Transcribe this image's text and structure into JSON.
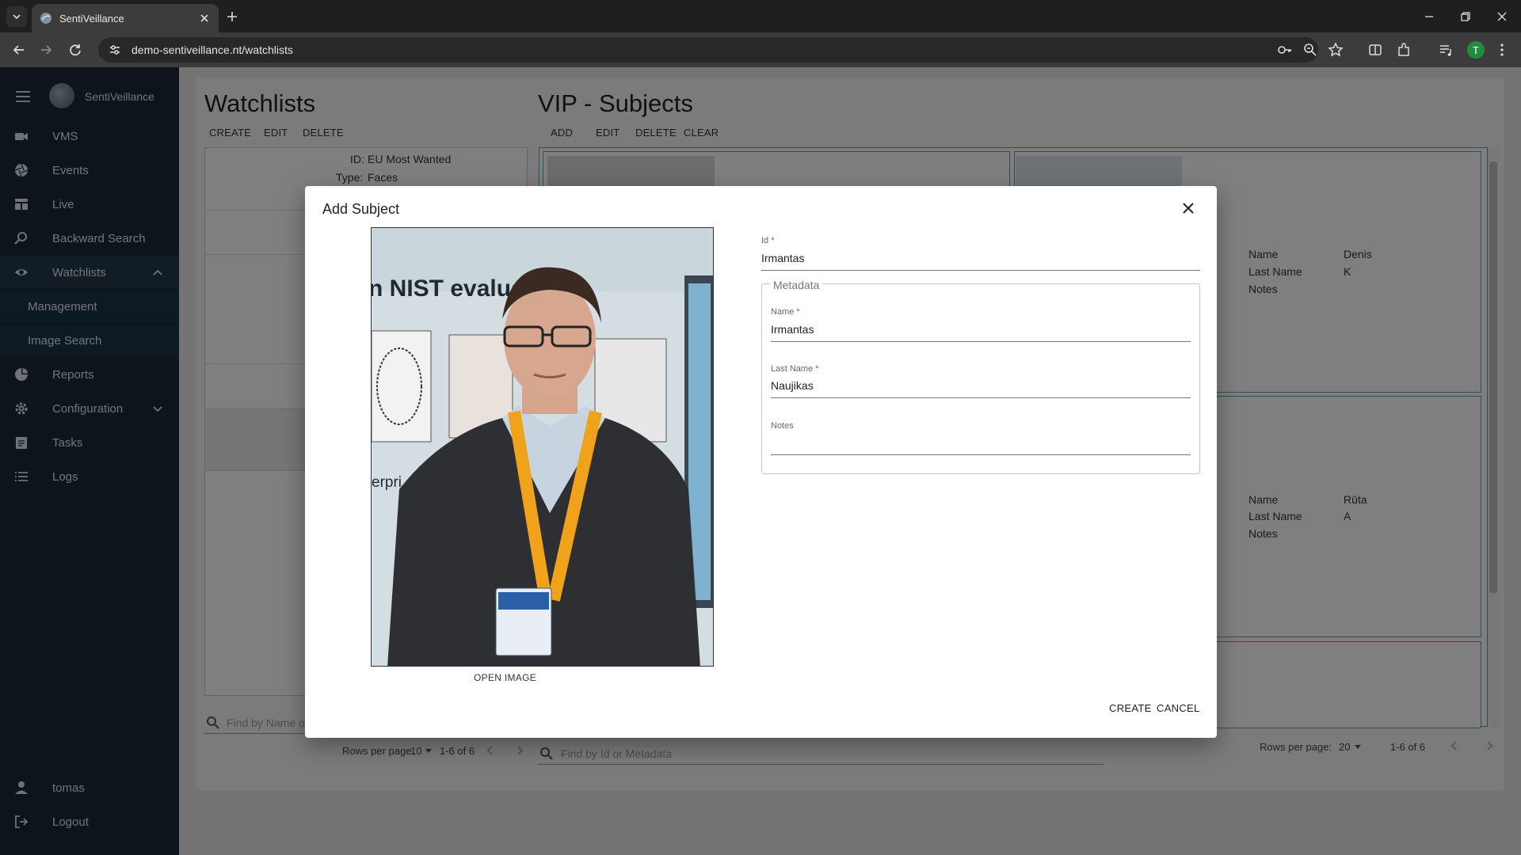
{
  "browser": {
    "tab_title": "SentiVeillance",
    "url": "demo-sentiveillance.nt/watchlists",
    "profile_initial": "T",
    "icons": [
      "tab-search-icon",
      "close-icon",
      "plus-icon",
      "minimize-icon",
      "restore-icon",
      "close-window-icon",
      "back-icon",
      "forward-icon",
      "reload-icon",
      "site-info-icon",
      "key-icon",
      "zoom-icon",
      "star-icon",
      "reading-mode-icon",
      "extensions-icon",
      "media-icon",
      "menu-dots-icon"
    ]
  },
  "sidebar": {
    "brand": "SentiVeillance",
    "items": [
      {
        "label": "VMS",
        "icon": "camera-icon"
      },
      {
        "label": "Events",
        "icon": "aperture-icon"
      },
      {
        "label": "Live",
        "icon": "grid-icon"
      },
      {
        "label": "Backward Search",
        "icon": "search-icon"
      },
      {
        "label": "Watchlists",
        "icon": "eye-icon"
      },
      {
        "label": "Management",
        "icon": ""
      },
      {
        "label": "Image Search",
        "icon": ""
      },
      {
        "label": "Reports",
        "icon": "pie-icon"
      },
      {
        "label": "Configuration",
        "icon": "gear-icon"
      },
      {
        "label": "Tasks",
        "icon": "clipboard-icon"
      },
      {
        "label": "Logs",
        "icon": "list-icon"
      }
    ],
    "user": "tomas",
    "logout": "Logout"
  },
  "watchlists": {
    "title": "Watchlists",
    "toolbar": {
      "create": "CREATE",
      "edit": "EDIT",
      "delete": "DELETE"
    },
    "selected": {
      "id_label": "ID:",
      "id_value": "EU Most Wanted",
      "type_label": "Type:",
      "type_value": "Faces"
    },
    "search_placeholder": "Find by Name o",
    "rows_per_page_label": "Rows per page",
    "rows_per_page": "10",
    "range": "1-6 of 6"
  },
  "subjects": {
    "title": "VIP - Subjects",
    "toolbar": {
      "add": "ADD",
      "edit": "EDIT",
      "delete": "DELETE",
      "clear": "CLEAR"
    },
    "card1": {
      "name_label": "Name",
      "name": "Denis",
      "last_label": "Last Name",
      "last": "K",
      "notes_label": "Notes"
    },
    "card2": {
      "name_label": "Name",
      "name": "Rūta",
      "last_label": "Last Name",
      "last": "A",
      "notes_label": "Notes"
    },
    "search_placeholder": "Find by Id or Metadata",
    "rows_per_page_label": "Rows per page:",
    "rows_per_page": "20",
    "range": "1-6 of 6"
  },
  "dialog": {
    "title": "Add Subject",
    "open_image": "OPEN IMAGE",
    "id_label": "Id *",
    "id_value": "Irmantas",
    "metadata_legend": "Metadata",
    "name_label": "Name *",
    "name_value": "Irmantas",
    "last_label": "Last Name *",
    "last_value": "Naujikas",
    "notes_label": "Notes",
    "notes_value": "",
    "create": "CREATE",
    "cancel": "CANCEL",
    "photo_poster_text": "n NIST evaluati",
    "photo_poster_text2": "erpri"
  }
}
